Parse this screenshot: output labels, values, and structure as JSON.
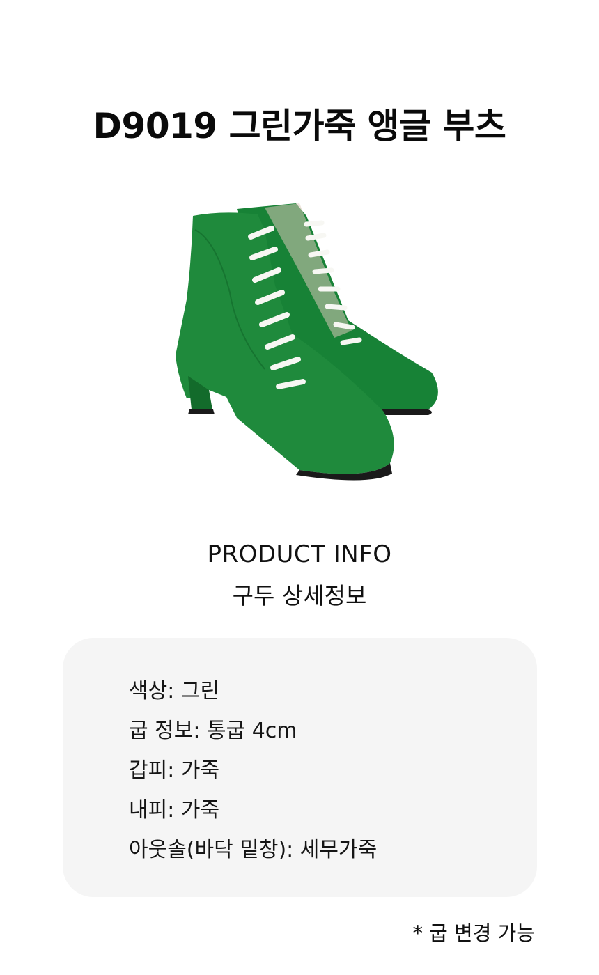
{
  "page": {
    "title": "D9019 그린가죽 앵글 부츠"
  },
  "product_image": {
    "icon": "green-leather-lace-up-ankle-boots-image",
    "colors": {
      "leather": "#1f8a3c",
      "leather_dark": "#136b2b",
      "laces": "#f7f7f3",
      "sole": "#1a1a1a",
      "lining": "#d8c9b8"
    }
  },
  "info": {
    "heading": "PRODUCT INFO",
    "subheading": "구두 상세정보"
  },
  "specs": [
    {
      "text": "색상: 그린"
    },
    {
      "text": "굽 정보: 통굽 4cm"
    },
    {
      "text": "갑피: 가죽"
    },
    {
      "text": "내피: 가죽"
    },
    {
      "text": "아웃솔(바닥 밑창): 세무가죽"
    }
  ],
  "note": "* 굽 변경 가능",
  "colors": {
    "spec_box_bg": "#f5f5f5",
    "text": "#111111"
  }
}
